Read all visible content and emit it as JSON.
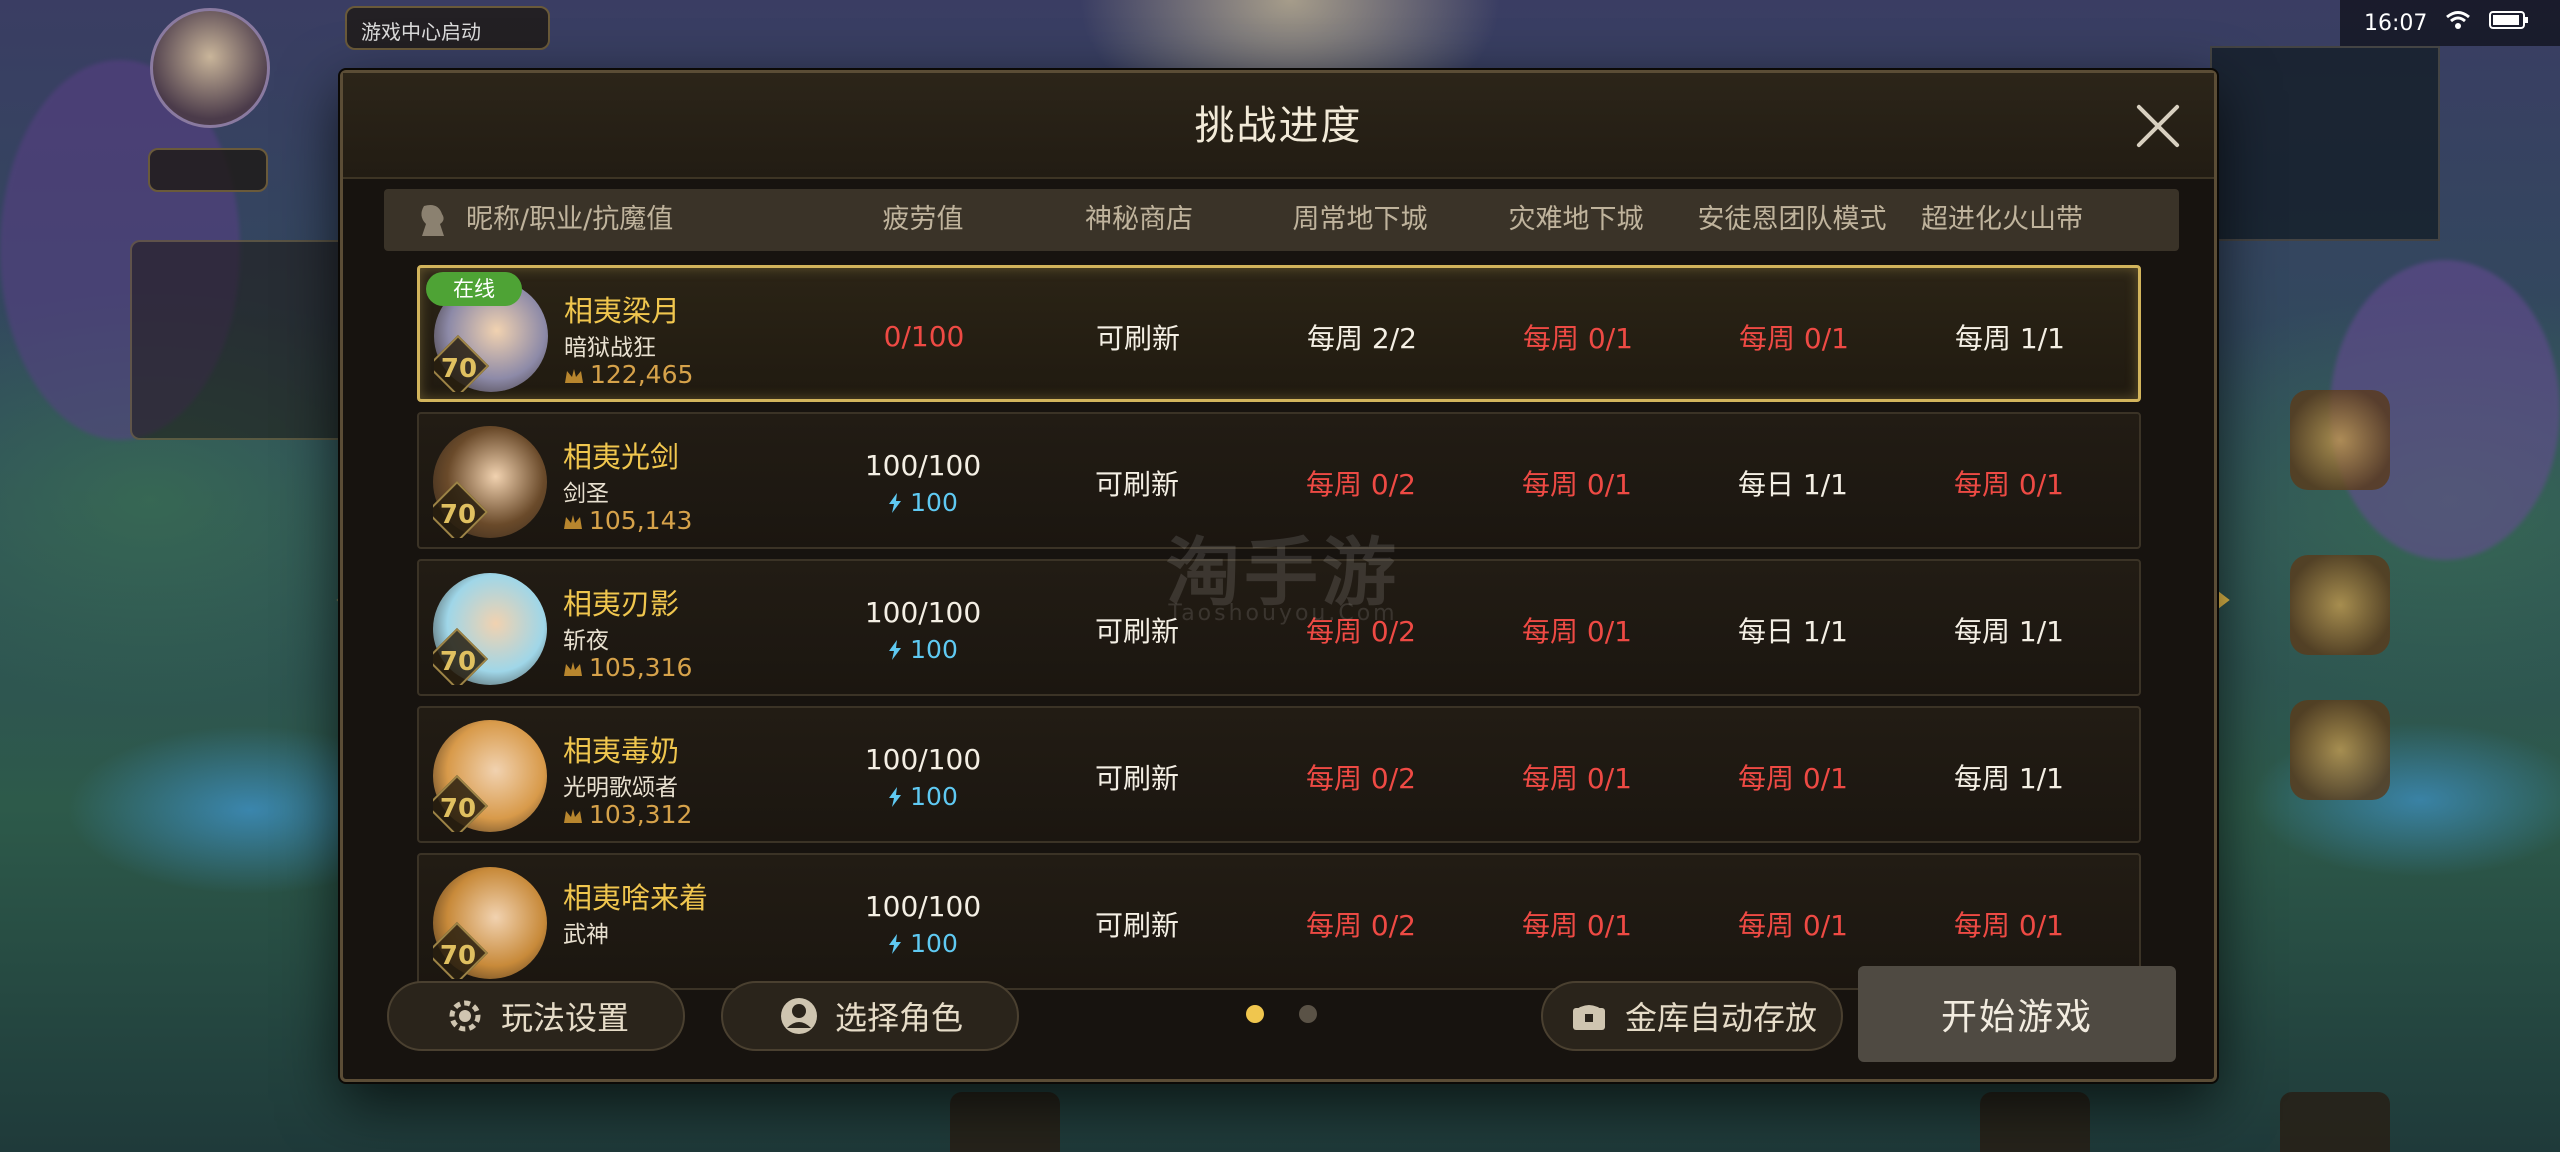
{
  "status_bar": {
    "time": "16:07",
    "battery_text": ""
  },
  "hud": {
    "game_center_chip": "游戏中心启动"
  },
  "modal": {
    "title": "挑战进度",
    "columns": [
      "昵称/职业/抗魔值",
      "疲劳值",
      "神秘商店",
      "周常地下城",
      "灾难地下城",
      "安徒恩团队模式",
      "超进化火山带"
    ],
    "online_label": "在线",
    "characters": [
      {
        "level": "70",
        "name": "相夷梁月",
        "job": "暗狱战狂",
        "power": "122,465",
        "fatigue": "0/100",
        "fatigue_sub": "",
        "shop": "可刷新",
        "weekly": "每周 2/2",
        "disaster": "每周 0/1",
        "anton": "每周 0/1",
        "volcano": "每周 1/1",
        "fatigue_color": "red",
        "weekly_color": "white",
        "disaster_color": "red",
        "anton_color": "red",
        "volcano_color": "white",
        "online": true,
        "selected": true,
        "portrait_color": "#8d8aa8"
      },
      {
        "level": "70",
        "name": "相夷光剑",
        "job": "剑圣",
        "power": "105,143",
        "fatigue": "100/100",
        "fatigue_sub": "100",
        "shop": "可刷新",
        "weekly": "每周 0/2",
        "disaster": "每周 0/1",
        "anton": "每日 1/1",
        "volcano": "每周 0/1",
        "fatigue_color": "white",
        "weekly_color": "red",
        "disaster_color": "red",
        "anton_color": "white",
        "volcano_color": "red",
        "online": false,
        "selected": false,
        "portrait_color": "#6a4a2a"
      },
      {
        "level": "70",
        "name": "相夷刃影",
        "job": "斩夜",
        "power": "105,316",
        "fatigue": "100/100",
        "fatigue_sub": "100",
        "shop": "可刷新",
        "weekly": "每周 0/2",
        "disaster": "每周 0/1",
        "anton": "每日 1/1",
        "volcano": "每周 1/1",
        "fatigue_color": "white",
        "weekly_color": "red",
        "disaster_color": "red",
        "anton_color": "white",
        "volcano_color": "white",
        "online": false,
        "selected": false,
        "portrait_color": "#9fd6e8"
      },
      {
        "level": "70",
        "name": "相夷毒奶",
        "job": "光明歌颂者",
        "power": "103,312",
        "fatigue": "100/100",
        "fatigue_sub": "100",
        "shop": "可刷新",
        "weekly": "每周 0/2",
        "disaster": "每周 0/1",
        "anton": "每周 0/1",
        "volcano": "每周 1/1",
        "fatigue_color": "white",
        "weekly_color": "red",
        "disaster_color": "red",
        "anton_color": "red",
        "volcano_color": "white",
        "online": false,
        "selected": false,
        "portrait_color": "#d89a4a"
      },
      {
        "level": "70",
        "name": "相夷啥来着",
        "job": "武神",
        "power": "",
        "fatigue": "100/100",
        "fatigue_sub": "100",
        "shop": "可刷新",
        "weekly": "每周 0/2",
        "disaster": "每周 0/1",
        "anton": "每周 0/1",
        "volcano": "每周 0/1",
        "fatigue_color": "white",
        "weekly_color": "red",
        "disaster_color": "red",
        "anton_color": "red",
        "volcano_color": "red",
        "online": false,
        "selected": false,
        "portrait_color": "#c88a3a"
      }
    ],
    "footer": {
      "settings_label": "玩法设置",
      "select_char_label": "选择角色",
      "auto_store_label": "金库自动存放",
      "start_label": "开始游戏",
      "page_dots": {
        "count": 2,
        "active": 0
      }
    },
    "watermark": {
      "main": "淘手游",
      "sub": "Taoshouyou.Com"
    }
  },
  "icons": {
    "close": "close-icon",
    "settings": "gear-icon",
    "select_char": "character-icon",
    "auto_store": "chest-icon",
    "prev": "chevron-left-icon",
    "next": "chevron-right-icon",
    "level": "level-diamond-icon",
    "power": "crown-icon",
    "fatigue": "bolt-icon"
  },
  "colors": {
    "accent_gold": "#d2b45c",
    "name_gold": "#f0c64e",
    "red_status": "#ee4a44",
    "fatigue_blue": "#5fc9f2",
    "online_green": "#4ea335"
  }
}
